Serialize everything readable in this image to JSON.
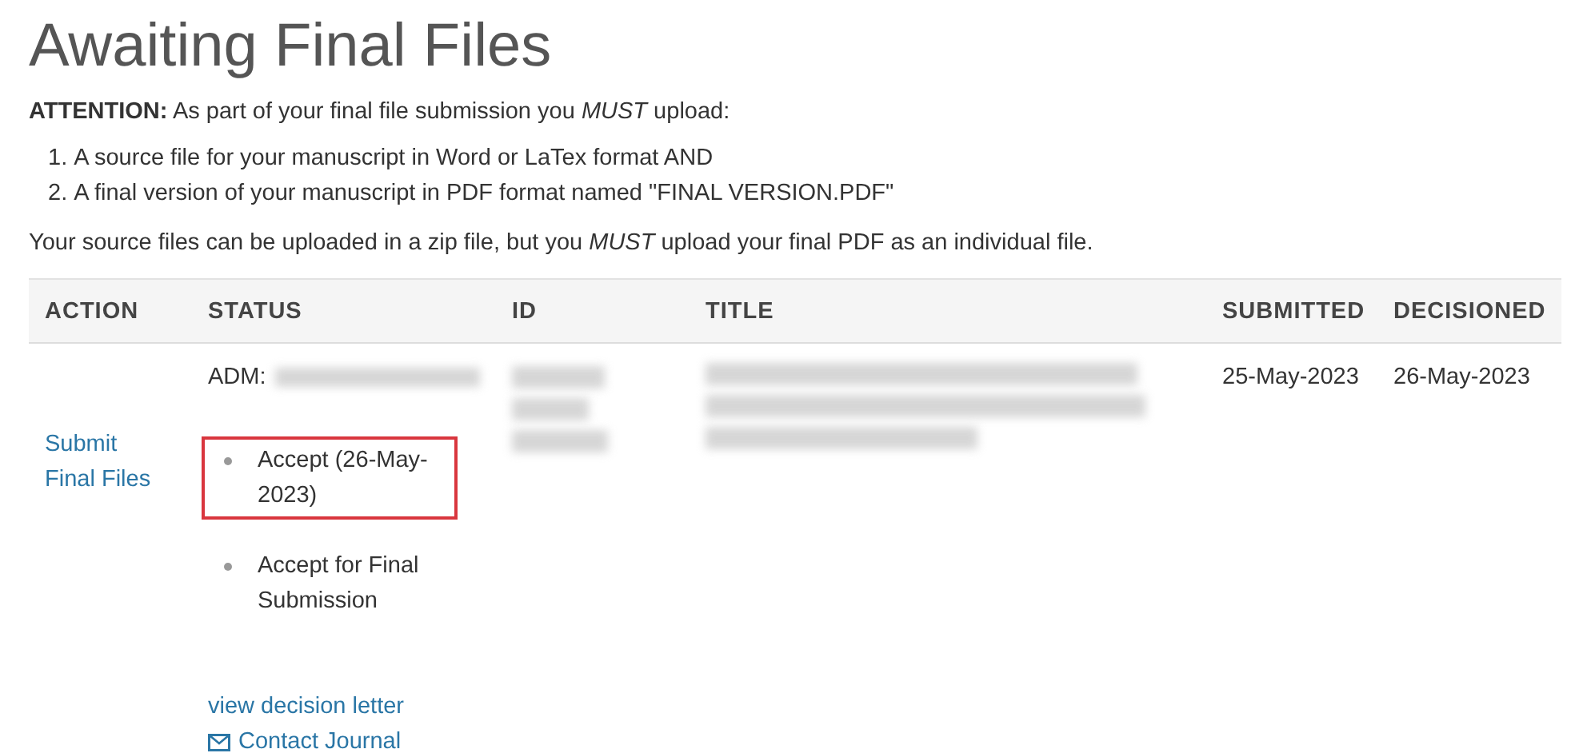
{
  "page_title": "Awaiting Final Files",
  "attention": {
    "label": "ATTENTION:",
    "text": "As part of your final file submission you *MUST* upload:"
  },
  "requirements": [
    {
      "marker": "1.",
      "text": "A source file for your manuscript in Word or LaTex format AND"
    },
    {
      "marker": "2.",
      "text": "A final version of your manuscript in PDF format named \"FINAL VERSION.PDF\""
    }
  ],
  "note": "Your source files can be uploaded in a zip file, but you *MUST* upload your final PDF as an individual file.",
  "table": {
    "columns": [
      "ACTION",
      "STATUS",
      "ID",
      "TITLE",
      "SUBMITTED",
      "DECISIONED"
    ],
    "rows": [
      {
        "action": "Submit Final Files",
        "status_label": "ADM:",
        "status_items": [
          {
            "text": "Accept (26-May-2023)",
            "highlighted": true
          },
          {
            "text": "Accept for Final Submission",
            "highlighted": false
          }
        ],
        "links": [
          {
            "kind": "text",
            "label": "view decision letter"
          },
          {
            "kind": "mail",
            "label": "Contact Journal"
          }
        ],
        "submitted": "25-May-2023",
        "decisioned": "26-May-2023"
      }
    ]
  }
}
